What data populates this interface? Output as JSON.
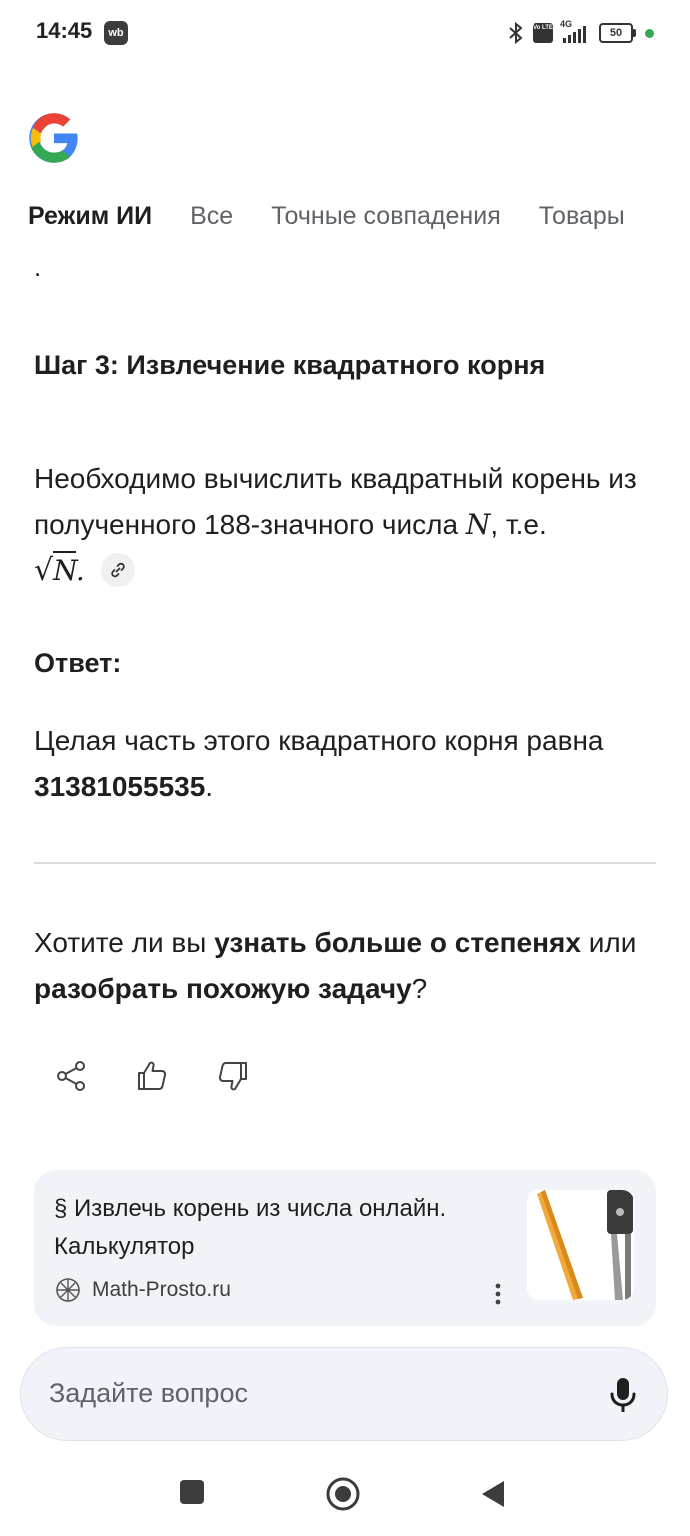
{
  "status_bar": {
    "time": "14:45",
    "app_badge": "wb",
    "network": "4G",
    "battery": "50",
    "volte_label": "Vo LTE"
  },
  "tabs": [
    {
      "label": "Режим ИИ",
      "active": true
    },
    {
      "label": "Все",
      "active": false
    },
    {
      "label": "Точные совпадения",
      "active": false
    },
    {
      "label": "Товары",
      "active": false
    }
  ],
  "content": {
    "leading_dot": ".",
    "step_heading": "Шаг 3: Извлечение квадратного корня",
    "step_text_1": "Необходимо вычислить квадратный корень из полученного 188-значного числа ",
    "step_var": "N",
    "step_text_2": ", т.е.",
    "sqrt_var": "N",
    "sqrt_after": ".",
    "answer_label": "Ответ:",
    "answer_text": "Целая часть этого квадратного корня равна ",
    "answer_value": "31381055535",
    "answer_end": ".",
    "followup_1": "Хотите ли вы ",
    "followup_bold_1": "узнать больше о степенях",
    "followup_2": " или ",
    "followup_bold_2": "разобрать похожую задачу",
    "followup_3": "?"
  },
  "source_card": {
    "title": "§ Извлечь корень из числа онлайн. Калькулятор",
    "site": "Math-Prosto.ru"
  },
  "ask": {
    "placeholder": "Задайте вопрос"
  },
  "colors": {
    "google_blue": "#4285f4",
    "google_red": "#ea4335",
    "google_yellow": "#fbbc05",
    "google_green": "#34a853",
    "card_bg": "#f0f4f9"
  }
}
